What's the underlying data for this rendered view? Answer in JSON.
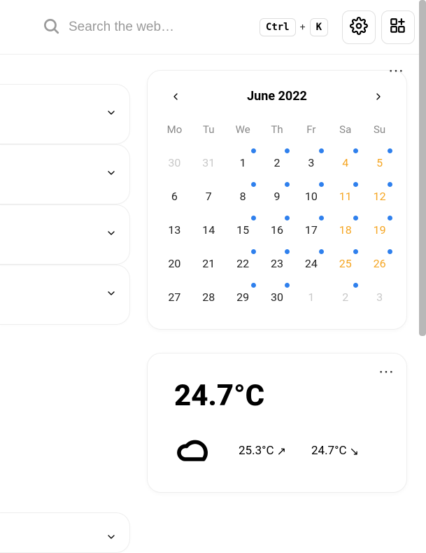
{
  "search": {
    "placeholder": "Search the web…"
  },
  "shortcut": {
    "key1": "Ctrl",
    "plus": "+",
    "key2": "K"
  },
  "calendar": {
    "title": "June 2022",
    "dow": [
      "Mo",
      "Tu",
      "We",
      "Th",
      "Fr",
      "Sa",
      "Su"
    ],
    "days": [
      {
        "n": "30",
        "out": true
      },
      {
        "n": "31",
        "out": true
      },
      {
        "n": "1",
        "dot": true
      },
      {
        "n": "2",
        "dot": true
      },
      {
        "n": "3",
        "dot": true
      },
      {
        "n": "4",
        "weekend": true,
        "dot": true
      },
      {
        "n": "5",
        "weekend": true,
        "dot": true
      },
      {
        "n": "6"
      },
      {
        "n": "7"
      },
      {
        "n": "8",
        "dot": true
      },
      {
        "n": "9",
        "dot": true
      },
      {
        "n": "10",
        "dot": true
      },
      {
        "n": "11",
        "weekend": true,
        "dot": true
      },
      {
        "n": "12",
        "weekend": true,
        "dot": true
      },
      {
        "n": "13"
      },
      {
        "n": "14"
      },
      {
        "n": "15",
        "dot": true
      },
      {
        "n": "16",
        "dot": true
      },
      {
        "n": "17",
        "dot": true
      },
      {
        "n": "18",
        "weekend": true,
        "dot": true
      },
      {
        "n": "19",
        "weekend": true,
        "dot": true
      },
      {
        "n": "20"
      },
      {
        "n": "21"
      },
      {
        "n": "22",
        "dot": true
      },
      {
        "n": "23",
        "dot": true
      },
      {
        "n": "24",
        "dot": true
      },
      {
        "n": "25",
        "weekend": true,
        "dot": true
      },
      {
        "n": "26",
        "weekend": true,
        "dot": true
      },
      {
        "n": "27"
      },
      {
        "n": "28"
      },
      {
        "n": "29",
        "dot": true
      },
      {
        "n": "30",
        "dot": true
      },
      {
        "n": "1",
        "out": true
      },
      {
        "n": "2",
        "out": true,
        "dot": true
      },
      {
        "n": "3",
        "out": true
      }
    ]
  },
  "weather": {
    "current": "24.7°C",
    "high": "25.3°C",
    "low": "24.7°C"
  }
}
